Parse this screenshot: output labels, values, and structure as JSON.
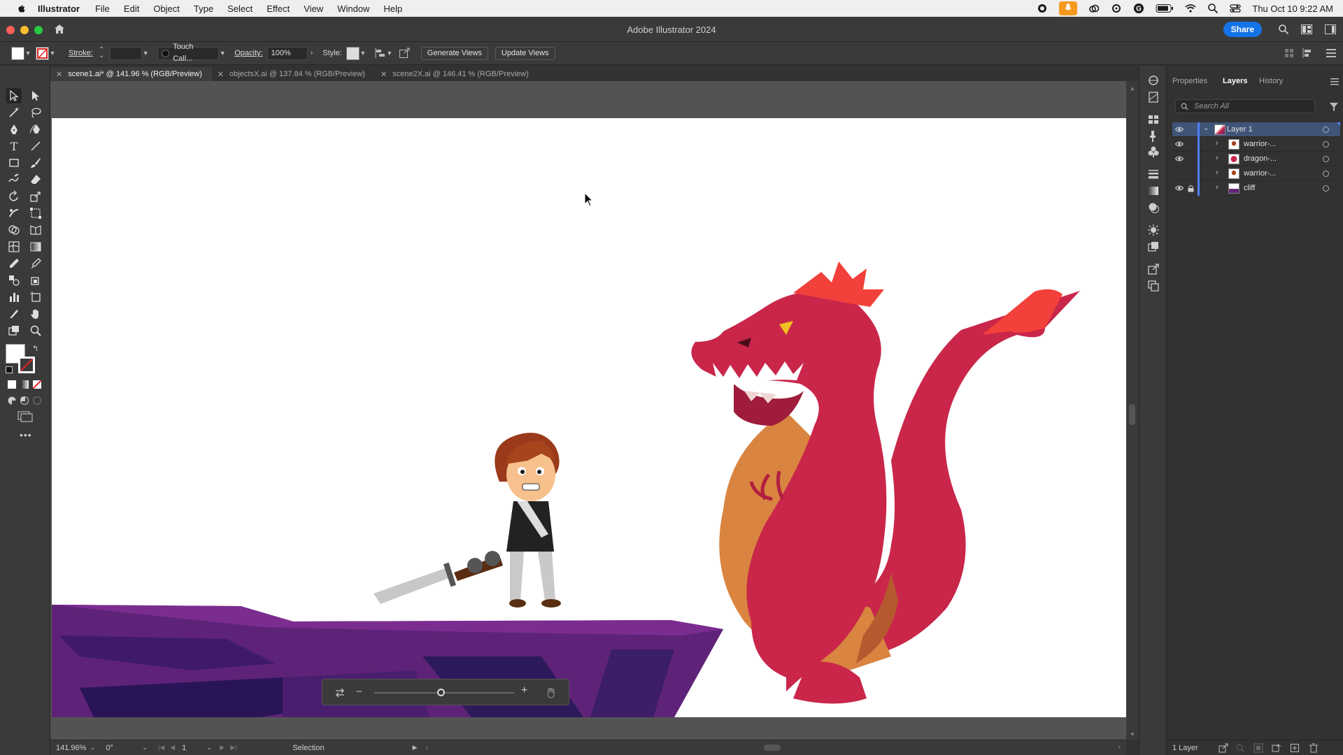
{
  "menubar": {
    "app_name": "Illustrator",
    "items": [
      "File",
      "Edit",
      "Object",
      "Type",
      "Select",
      "Effect",
      "View",
      "Window",
      "Help"
    ],
    "clock": "Thu Oct 10  9:22 AM"
  },
  "window": {
    "title": "Adobe Illustrator 2024",
    "share_label": "Share"
  },
  "control_bar": {
    "stroke_label": "Stroke:",
    "brush_name": "Touch Call...",
    "opacity_label": "Opacity:",
    "opacity_value": "100%",
    "style_label": "Style:",
    "generate_views": "Generate Views",
    "update_views": "Update Views"
  },
  "doc_tabs": [
    {
      "label": "scene1.ai* @ 141.96 % (RGB/Preview)",
      "active": true
    },
    {
      "label": "objectsX.ai @ 137.84 % (RGB/Preview)",
      "active": false
    },
    {
      "label": "scene2X.ai @ 146.41 % (RGB/Preview)",
      "active": false
    }
  ],
  "panel": {
    "tabs": [
      "Properties",
      "Layers",
      "History"
    ],
    "active_tab": "Layers",
    "search_placeholder": "Search All",
    "layers": [
      {
        "name": "Layer 1",
        "level": 0,
        "selected": true
      },
      {
        "name": "warrior-...",
        "level": 1
      },
      {
        "name": "dragon-...",
        "level": 1
      },
      {
        "name": "warrior-...",
        "level": 1
      },
      {
        "name": "cliff",
        "level": 1,
        "locked": true
      }
    ],
    "footer_count": "1 Layer"
  },
  "status_bar": {
    "zoom": "141.96%",
    "rotation": "0°",
    "artboard_number": "1",
    "tool": "Selection"
  },
  "colors": {
    "accent": "#1473e6",
    "dragon": "#c9264a",
    "dragon_belly": "#d98440",
    "crest": "#f2403a",
    "cliff": "#5e2378"
  }
}
